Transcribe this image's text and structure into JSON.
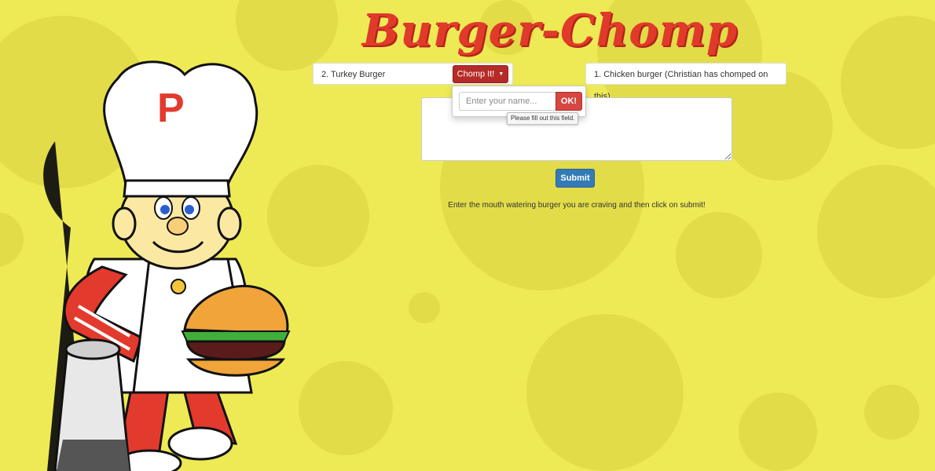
{
  "app": {
    "title": "Burger-Chomp"
  },
  "uneaten": [
    {
      "label": "2. Turkey Burger"
    }
  ],
  "eaten": [
    {
      "label": "1. Chicken burger (Christian has chomped on this)"
    }
  ],
  "chomp_button": {
    "label": "Chomp It!"
  },
  "chomp_dropdown": {
    "name_placeholder": "Enter your name...",
    "ok_label": "OK!",
    "validation_tooltip": "Please fill out this field."
  },
  "form": {
    "submit_label": "Submit",
    "hint": "Enter the mouth watering burger you are craving and then click on submit!"
  },
  "colors": {
    "background": "#eeea55",
    "dots": "#e2dc48",
    "title": "#e03a2b",
    "chomp_button": "#b52b27",
    "submit_button": "#337ab7"
  },
  "mascot": {
    "emblem_letter": "P"
  }
}
